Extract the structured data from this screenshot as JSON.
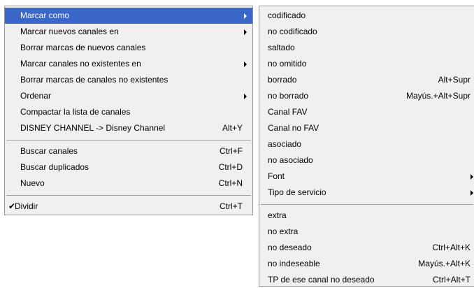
{
  "main_menu": {
    "group1": [
      {
        "label": "Marcar como",
        "shortcut": "",
        "submenu": true
      },
      {
        "label": "Marcar nuevos canales en",
        "shortcut": "",
        "submenu": true
      },
      {
        "label": "Borrar marcas de nuevos canales",
        "shortcut": "",
        "submenu": false
      },
      {
        "label": "Marcar canales no existentes en",
        "shortcut": "",
        "submenu": true
      },
      {
        "label": "Borrar marcas de canales no existentes",
        "shortcut": "",
        "submenu": false
      },
      {
        "label": "Ordenar",
        "shortcut": "",
        "submenu": true
      },
      {
        "label": "Compactar la lista de canales",
        "shortcut": "",
        "submenu": false
      },
      {
        "label": "DISNEY CHANNEL -> Disney Channel",
        "shortcut": "Alt+Y",
        "submenu": false
      }
    ],
    "group2": [
      {
        "label": "Buscar canales",
        "shortcut": "Ctrl+F"
      },
      {
        "label": "Buscar duplicados",
        "shortcut": "Ctrl+D"
      },
      {
        "label": "Nuevo",
        "shortcut": "Ctrl+N"
      }
    ],
    "group3": [
      {
        "label": "Dividir",
        "shortcut": "Ctrl+T",
        "checked": true,
        "check_glyph": "✔"
      }
    ]
  },
  "sub_menu": {
    "group1": [
      {
        "label": "codificado",
        "shortcut": ""
      },
      {
        "label": "no codificado",
        "shortcut": ""
      },
      {
        "label": "saltado",
        "shortcut": ""
      },
      {
        "label": "no omitido",
        "shortcut": ""
      },
      {
        "label": "borrado",
        "shortcut": "Alt+Supr"
      },
      {
        "label": "no borrado",
        "shortcut": "Mayús.+Alt+Supr"
      },
      {
        "label": "Canal FAV",
        "shortcut": ""
      },
      {
        "label": "Canal no FAV",
        "shortcut": ""
      },
      {
        "label": "asociado",
        "shortcut": ""
      },
      {
        "label": "no asociado",
        "shortcut": ""
      },
      {
        "label": "Font",
        "shortcut": ""
      },
      {
        "label": "Tipo de servicio",
        "shortcut": ""
      }
    ],
    "group2": [
      {
        "label": "extra",
        "shortcut": ""
      },
      {
        "label": "no extra",
        "shortcut": ""
      },
      {
        "label": "no deseado",
        "shortcut": "Ctrl+Alt+K"
      },
      {
        "label": "no indeseable",
        "shortcut": "Mayús.+Alt+K"
      },
      {
        "label": "TP de ese canal no deseado",
        "shortcut": "Ctrl+Alt+T"
      }
    ]
  },
  "colors": {
    "menu_bg": "#f0f0f0",
    "highlight": "#3b67c9",
    "border": "#979797"
  },
  "icons": {
    "submenu_arrow": "submenu-arrow-icon",
    "checkmark": "checkmark-icon"
  }
}
